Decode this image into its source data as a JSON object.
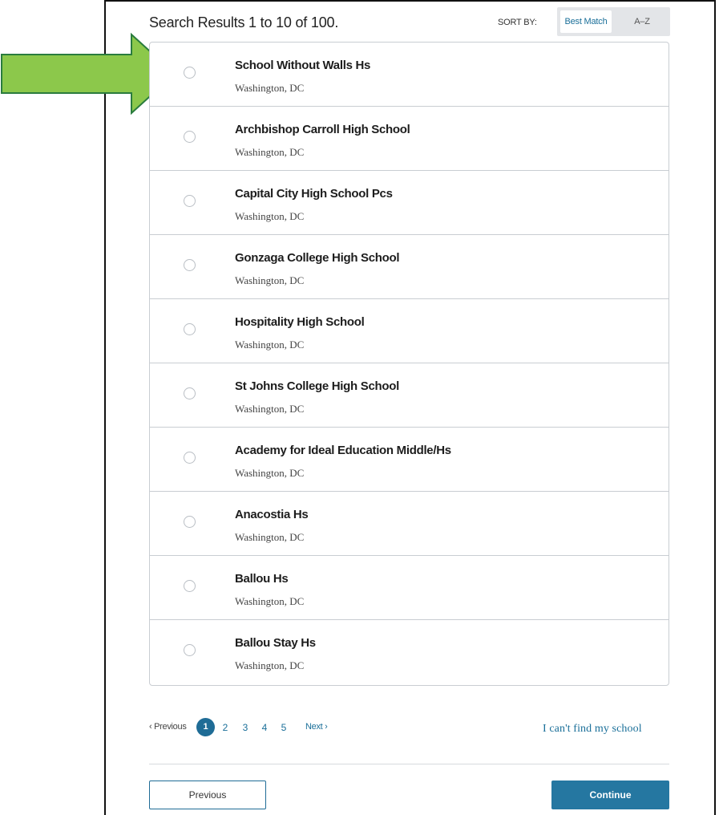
{
  "results": {
    "title": "Search Results 1 to 10 of 100.",
    "sort_label": "SORT BY:",
    "sort_options": [
      "Best Match",
      "A–Z"
    ],
    "sort_selected": "Best Match"
  },
  "schools": [
    {
      "name": "School Without Walls Hs",
      "location": "Washington, DC"
    },
    {
      "name": "Archbishop Carroll High School",
      "location": "Washington, DC"
    },
    {
      "name": "Capital City High School Pcs",
      "location": "Washington, DC"
    },
    {
      "name": "Gonzaga College High School",
      "location": "Washington, DC"
    },
    {
      "name": "Hospitality High School",
      "location": "Washington, DC"
    },
    {
      "name": "St Johns College High School",
      "location": "Washington, DC"
    },
    {
      "name": "Academy for Ideal Education Middle/Hs",
      "location": "Washington, DC"
    },
    {
      "name": "Anacostia Hs",
      "location": "Washington, DC"
    },
    {
      "name": "Ballou Hs",
      "location": "Washington, DC"
    },
    {
      "name": "Ballou Stay Hs",
      "location": "Washington, DC"
    }
  ],
  "pagination": {
    "previous_label": "‹ Previous",
    "pages": [
      "1",
      "2",
      "3",
      "4",
      "5"
    ],
    "current_page": "1",
    "next_label": "Next ›"
  },
  "cant_find_label": "I can't find my school",
  "footer": {
    "previous_label": "Previous",
    "continue_label": "Continue"
  },
  "colors": {
    "accent": "#1f6c96",
    "arrow_fill": "#8cc84b",
    "arrow_stroke": "#2a7c3e"
  },
  "icons": {
    "pointer": "green-arrow-icon"
  }
}
